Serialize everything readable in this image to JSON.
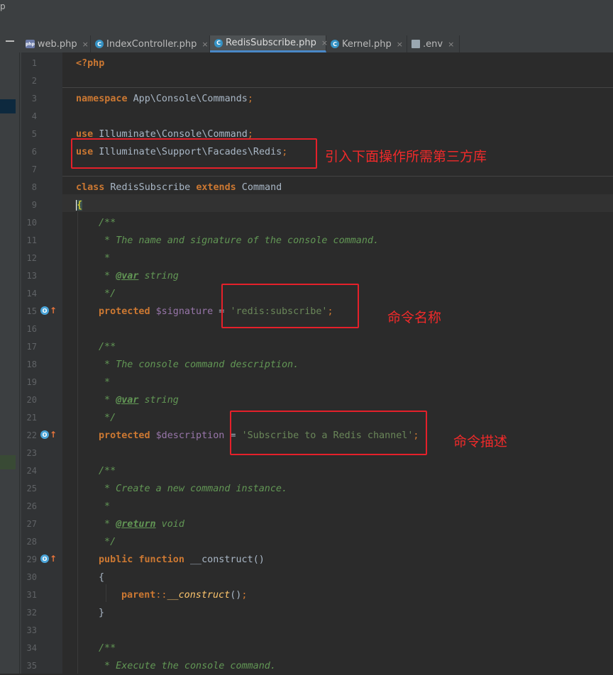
{
  "window": {
    "corner_glyph": "p"
  },
  "tabs": [
    {
      "label": "web.php",
      "icon": "php-file-icon",
      "active": false
    },
    {
      "label": "IndexController.php",
      "icon": "class-icon",
      "active": false
    },
    {
      "label": "RedisSubscribe.php",
      "icon": "class-icon",
      "active": true
    },
    {
      "label": "Kernel.php",
      "icon": "class-icon",
      "active": false
    },
    {
      "label": ".env",
      "icon": "text-file-icon",
      "active": false
    }
  ],
  "tab_close_glyph": "×",
  "line_numbers": [
    "1",
    "2",
    "3",
    "4",
    "5",
    "6",
    "7",
    "8",
    "9",
    "10",
    "11",
    "12",
    "13",
    "14",
    "15",
    "16",
    "17",
    "18",
    "19",
    "20",
    "21",
    "22",
    "23",
    "24",
    "25",
    "26",
    "27",
    "28",
    "29",
    "30",
    "31",
    "32",
    "33",
    "34",
    "35"
  ],
  "code": {
    "l1_open": "<?php",
    "l3_kw": "namespace",
    "l3_rest": " App\\Console\\Commands",
    "semi": ";",
    "use_kw": "use",
    "l5_rest": " Illuminate\\Console\\Command",
    "l6_rest": " Illuminate\\Support\\Facades\\Redis",
    "class_kw": "class",
    "l8_name": " RedisSubscribe ",
    "extends_kw": "extends",
    "l8_parent": " Command",
    "open_brace": "{",
    "close_brace": "}",
    "doc_open": "/**",
    "doc_star": " *",
    "doc_close": " */",
    "l11_text": " * The name and signature of the console command.",
    "var_tag": "@var",
    "var_type": " string",
    "protected_kw": "protected",
    "sig_var": "$signature",
    "eq": " = ",
    "sig_val": "'redis:subscribe'",
    "l18_text": " * The console command description.",
    "desc_var": "$description",
    "desc_val": "'Subscribe to a Redis channel'",
    "l25_text": " * Create a new command instance.",
    "return_tag": "@return",
    "return_type": " void",
    "public_kw": "public",
    "function_kw": "function",
    "construct_name": " __construct",
    "parens": "()",
    "parent_kw": "parent",
    "dcolon": "::",
    "construct_call": "__construct",
    "l35_text": " * Execute the console command."
  },
  "annotations": {
    "imports_note": "引入下面操作所需第三方库",
    "name_note": "命令名称",
    "desc_note": "命令描述"
  },
  "colors": {
    "keyword": "#cc7832",
    "string": "#6a8759",
    "comment": "#629755",
    "variable": "#9876aa",
    "annotation_red": "#e5202a",
    "active_tab_underline": "#4a88c7"
  }
}
